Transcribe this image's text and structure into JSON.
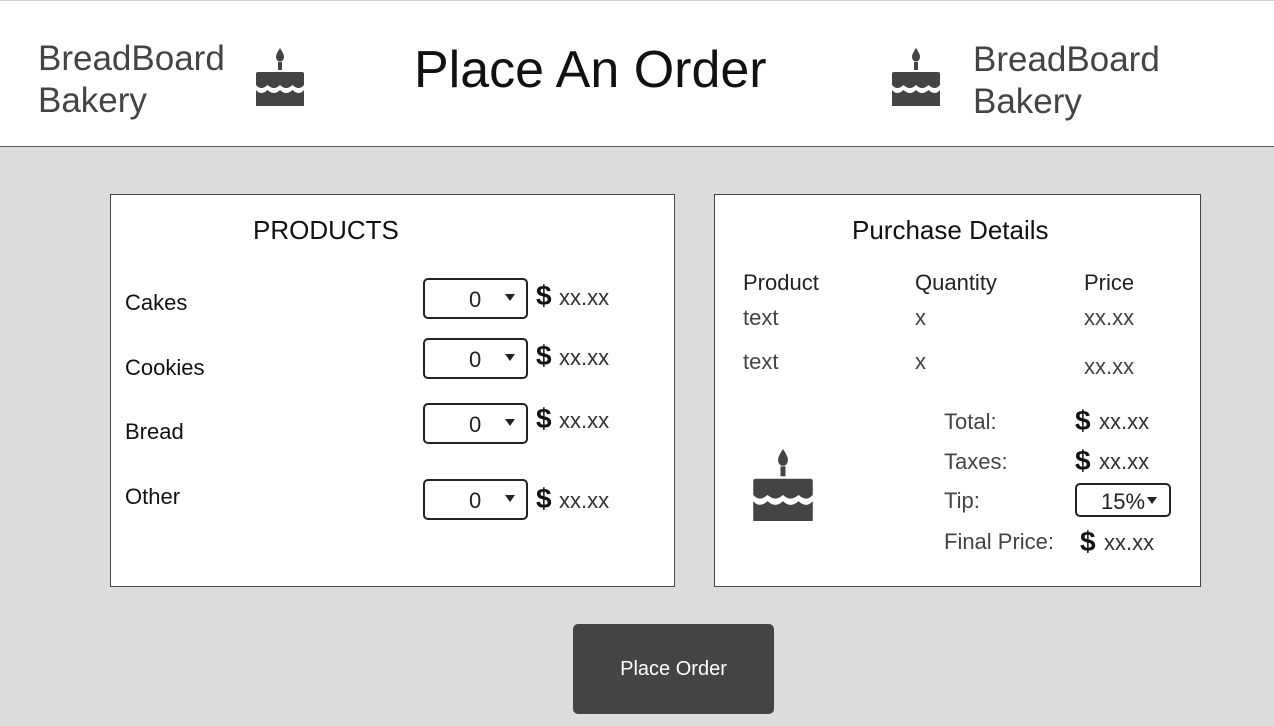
{
  "header": {
    "brand_left": "BreadBoard Bakery",
    "brand_right": "BreadBoard Bakery",
    "title": "Place An Order"
  },
  "products": {
    "title": "PRODUCTS",
    "items": [
      {
        "label": "Cakes",
        "qty": "0",
        "price": "xx.xx"
      },
      {
        "label": "Cookies",
        "qty": "0",
        "price": "xx.xx"
      },
      {
        "label": "Bread",
        "qty": "0",
        "price": "xx.xx"
      },
      {
        "label": "Other",
        "qty": "0",
        "price": "xx.xx"
      }
    ]
  },
  "details": {
    "title": "Purchase Details",
    "columns": [
      "Product",
      "Quantity",
      "Price"
    ],
    "rows": [
      {
        "product": "text",
        "quantity": "x",
        "price": "xx.xx"
      },
      {
        "product": "text",
        "quantity": "x",
        "price": "xx.xx"
      }
    ],
    "summary": {
      "total_label": "Total:",
      "total_value": "xx.xx",
      "taxes_label": "Taxes:",
      "taxes_value": "xx.xx",
      "tip_label": "Tip:",
      "tip_value": "15%",
      "final_label": "Final Price:",
      "final_value": "xx.xx"
    }
  },
  "currency_symbol": "$",
  "place_order_label": "Place Order",
  "icons": {
    "logo": "cake-icon",
    "currency": "dollar-icon",
    "dropdown": "chevron-down-icon"
  },
  "colors": {
    "header_bg": "#ffffff",
    "page_bg": "#dcdcdc",
    "button_bg": "#444444",
    "text_dark": "#222222"
  }
}
